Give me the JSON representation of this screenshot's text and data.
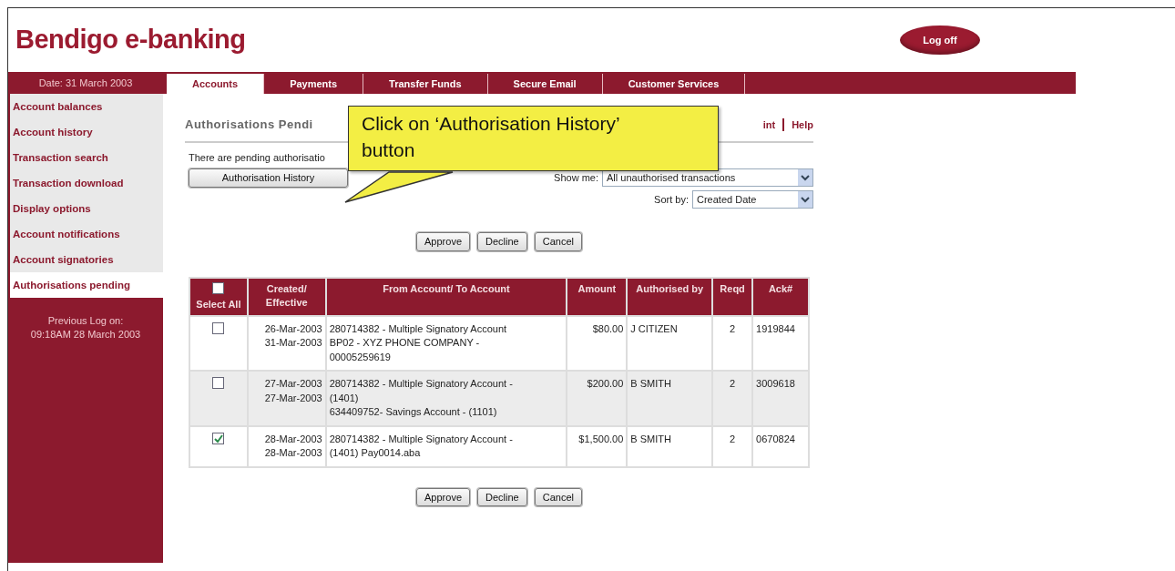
{
  "header": {
    "title": "Bendigo e-banking",
    "logoff_button": "Log off"
  },
  "sidebar": {
    "date": "Date: 31 March 2003",
    "items": [
      {
        "label": "Account balances",
        "selected": false
      },
      {
        "label": "Account history",
        "selected": false
      },
      {
        "label": "Transaction search",
        "selected": false
      },
      {
        "label": "Transaction download",
        "selected": false
      },
      {
        "label": "Display options",
        "selected": false
      },
      {
        "label": "Account notifications",
        "selected": false
      },
      {
        "label": "Account signatories",
        "selected": false
      },
      {
        "label": "Authorisations pending",
        "selected": true
      }
    ],
    "previous_logon": [
      "Previous Log on:",
      "09:18AM 28 March 2003"
    ]
  },
  "tabs": [
    {
      "label": "Accounts",
      "selected": true
    },
    {
      "label": "Payments",
      "selected": false
    },
    {
      "label": "Transfer Funds",
      "selected": false
    },
    {
      "label": "Secure Email",
      "selected": false
    },
    {
      "label": "Customer Services",
      "selected": false
    }
  ],
  "page": {
    "heading": "Authorisations Pendi",
    "links": [
      "int",
      "Help"
    ],
    "notice": "There are pending authorisatio",
    "history_button": "Authorisation History",
    "show_me": {
      "label": "Show me:",
      "value": "All unauthorised transactions"
    },
    "sort_by": {
      "label": "Sort by:",
      "value": "Created Date"
    },
    "action_buttons": [
      "Approve",
      "Decline",
      "Cancel"
    ]
  },
  "table": {
    "select_all": {
      "label": "Select All",
      "checked": false
    },
    "columns": [
      "Created/ Effective",
      "From Account/ To Account",
      "Amount",
      "Authorised by",
      "Reqd",
      "Ack#"
    ],
    "rows": [
      {
        "selected": false,
        "dates": [
          "26-Mar-2003",
          "31-Mar-2003"
        ],
        "accounts": [
          "280714382 - Multiple Signatory Account",
          "BP02 - XYZ PHONE COMPANY -",
          "00005259619"
        ],
        "amount": "$80.00",
        "authorised_by": "J CITIZEN",
        "reqd": "2",
        "ack": "1919844"
      },
      {
        "selected": false,
        "dates": [
          "27-Mar-2003",
          "27-Mar-2003"
        ],
        "accounts": [
          "280714382 - Multiple Signatory Account -",
          "(1401)",
          "634409752- Savings Account - (1101)"
        ],
        "amount": "$200.00",
        "authorised_by": "B SMITH",
        "reqd": "2",
        "ack": "3009618"
      },
      {
        "selected": true,
        "dates": [
          "28-Mar-2003",
          "28-Mar-2003"
        ],
        "accounts": [
          "280714382 - Multiple Signatory Account -",
          "(1401) Pay0014.aba"
        ],
        "amount": "$1,500.00",
        "authorised_by": "B SMITH",
        "reqd": "2",
        "ack": "0670824"
      }
    ]
  },
  "bottom_buttons": [
    "Approve",
    "Decline",
    "Cancel"
  ],
  "callout": {
    "text": "Click on ‘Authorisation History’ button"
  }
}
